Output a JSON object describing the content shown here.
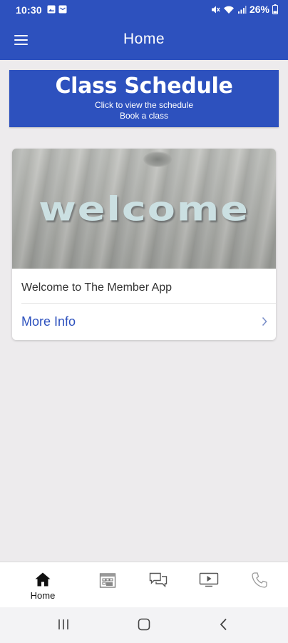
{
  "status_bar": {
    "time": "10:30",
    "battery": "26%"
  },
  "app_bar": {
    "title": "Home",
    "menu_icon": "hamburger-menu-icon"
  },
  "schedule_banner": {
    "title": "Class Schedule",
    "line1": "Click to view the schedule",
    "line2": "Book a class"
  },
  "welcome_card": {
    "image_text": "welcome",
    "body": "Welcome to The Member App",
    "link_label": "More Info",
    "link_icon": "chevron-right-icon"
  },
  "bottom_nav": {
    "items": [
      {
        "label": "Home",
        "icon": "home-icon",
        "active": true
      },
      {
        "label": "",
        "icon": "calendar-icon",
        "active": false
      },
      {
        "label": "",
        "icon": "chat-icon",
        "active": false
      },
      {
        "label": "",
        "icon": "video-icon",
        "active": false
      },
      {
        "label": "",
        "icon": "phone-icon",
        "active": false
      }
    ]
  },
  "colors": {
    "brand_blue": "#2d51be",
    "background": "#edebed",
    "link_blue": "#2d51be"
  }
}
